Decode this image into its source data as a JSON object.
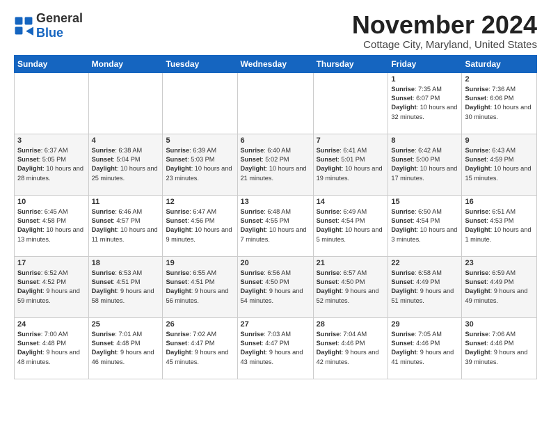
{
  "logo": {
    "general": "General",
    "blue": "Blue"
  },
  "title": "November 2024",
  "subtitle": "Cottage City, Maryland, United States",
  "days_header": [
    "Sunday",
    "Monday",
    "Tuesday",
    "Wednesday",
    "Thursday",
    "Friday",
    "Saturday"
  ],
  "weeks": [
    [
      {
        "day": "",
        "content": ""
      },
      {
        "day": "",
        "content": ""
      },
      {
        "day": "",
        "content": ""
      },
      {
        "day": "",
        "content": ""
      },
      {
        "day": "",
        "content": ""
      },
      {
        "day": "1",
        "content": "Sunrise: 7:35 AM\nSunset: 6:07 PM\nDaylight: 10 hours and 32 minutes."
      },
      {
        "day": "2",
        "content": "Sunrise: 7:36 AM\nSunset: 6:06 PM\nDaylight: 10 hours and 30 minutes."
      }
    ],
    [
      {
        "day": "3",
        "content": "Sunrise: 6:37 AM\nSunset: 5:05 PM\nDaylight: 10 hours and 28 minutes."
      },
      {
        "day": "4",
        "content": "Sunrise: 6:38 AM\nSunset: 5:04 PM\nDaylight: 10 hours and 25 minutes."
      },
      {
        "day": "5",
        "content": "Sunrise: 6:39 AM\nSunset: 5:03 PM\nDaylight: 10 hours and 23 minutes."
      },
      {
        "day": "6",
        "content": "Sunrise: 6:40 AM\nSunset: 5:02 PM\nDaylight: 10 hours and 21 minutes."
      },
      {
        "day": "7",
        "content": "Sunrise: 6:41 AM\nSunset: 5:01 PM\nDaylight: 10 hours and 19 minutes."
      },
      {
        "day": "8",
        "content": "Sunrise: 6:42 AM\nSunset: 5:00 PM\nDaylight: 10 hours and 17 minutes."
      },
      {
        "day": "9",
        "content": "Sunrise: 6:43 AM\nSunset: 4:59 PM\nDaylight: 10 hours and 15 minutes."
      }
    ],
    [
      {
        "day": "10",
        "content": "Sunrise: 6:45 AM\nSunset: 4:58 PM\nDaylight: 10 hours and 13 minutes."
      },
      {
        "day": "11",
        "content": "Sunrise: 6:46 AM\nSunset: 4:57 PM\nDaylight: 10 hours and 11 minutes."
      },
      {
        "day": "12",
        "content": "Sunrise: 6:47 AM\nSunset: 4:56 PM\nDaylight: 10 hours and 9 minutes."
      },
      {
        "day": "13",
        "content": "Sunrise: 6:48 AM\nSunset: 4:55 PM\nDaylight: 10 hours and 7 minutes."
      },
      {
        "day": "14",
        "content": "Sunrise: 6:49 AM\nSunset: 4:54 PM\nDaylight: 10 hours and 5 minutes."
      },
      {
        "day": "15",
        "content": "Sunrise: 6:50 AM\nSunset: 4:54 PM\nDaylight: 10 hours and 3 minutes."
      },
      {
        "day": "16",
        "content": "Sunrise: 6:51 AM\nSunset: 4:53 PM\nDaylight: 10 hours and 1 minute."
      }
    ],
    [
      {
        "day": "17",
        "content": "Sunrise: 6:52 AM\nSunset: 4:52 PM\nDaylight: 9 hours and 59 minutes."
      },
      {
        "day": "18",
        "content": "Sunrise: 6:53 AM\nSunset: 4:51 PM\nDaylight: 9 hours and 58 minutes."
      },
      {
        "day": "19",
        "content": "Sunrise: 6:55 AM\nSunset: 4:51 PM\nDaylight: 9 hours and 56 minutes."
      },
      {
        "day": "20",
        "content": "Sunrise: 6:56 AM\nSunset: 4:50 PM\nDaylight: 9 hours and 54 minutes."
      },
      {
        "day": "21",
        "content": "Sunrise: 6:57 AM\nSunset: 4:50 PM\nDaylight: 9 hours and 52 minutes."
      },
      {
        "day": "22",
        "content": "Sunrise: 6:58 AM\nSunset: 4:49 PM\nDaylight: 9 hours and 51 minutes."
      },
      {
        "day": "23",
        "content": "Sunrise: 6:59 AM\nSunset: 4:49 PM\nDaylight: 9 hours and 49 minutes."
      }
    ],
    [
      {
        "day": "24",
        "content": "Sunrise: 7:00 AM\nSunset: 4:48 PM\nDaylight: 9 hours and 48 minutes."
      },
      {
        "day": "25",
        "content": "Sunrise: 7:01 AM\nSunset: 4:48 PM\nDaylight: 9 hours and 46 minutes."
      },
      {
        "day": "26",
        "content": "Sunrise: 7:02 AM\nSunset: 4:47 PM\nDaylight: 9 hours and 45 minutes."
      },
      {
        "day": "27",
        "content": "Sunrise: 7:03 AM\nSunset: 4:47 PM\nDaylight: 9 hours and 43 minutes."
      },
      {
        "day": "28",
        "content": "Sunrise: 7:04 AM\nSunset: 4:46 PM\nDaylight: 9 hours and 42 minutes."
      },
      {
        "day": "29",
        "content": "Sunrise: 7:05 AM\nSunset: 4:46 PM\nDaylight: 9 hours and 41 minutes."
      },
      {
        "day": "30",
        "content": "Sunrise: 7:06 AM\nSunset: 4:46 PM\nDaylight: 9 hours and 39 minutes."
      }
    ]
  ]
}
